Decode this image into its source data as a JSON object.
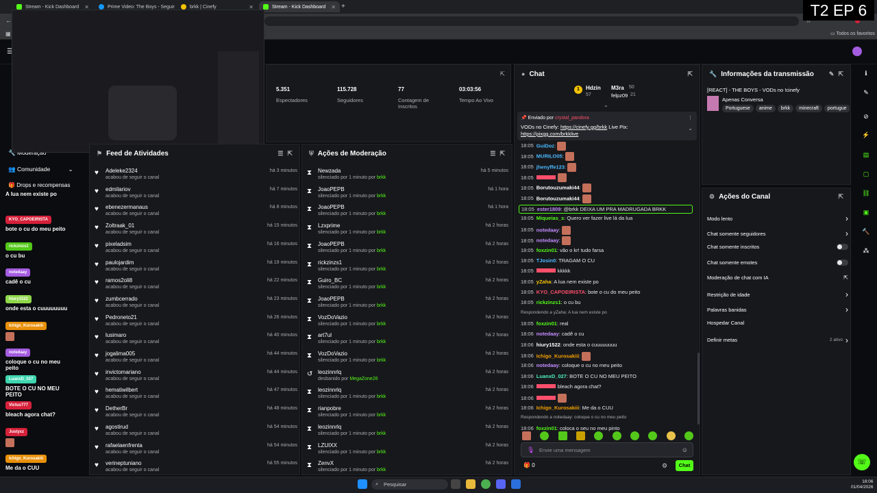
{
  "tabs": [
    {
      "label": "Stream - Kick Dashboard",
      "fav": "#53fc18"
    },
    {
      "label": "Prime Video: The Boys - Seguir",
      "fav": "#1399ff"
    },
    {
      "label": "brkk | Cinefy",
      "fav": "#f4c300"
    },
    {
      "label": "Stream - Kick Dashboard",
      "fav": "#53fc18"
    }
  ],
  "badge": "T2 EP 6",
  "bookmarks": "Todos os favoritos",
  "stats": [
    {
      "value": "5.351",
      "label": "Espectadores"
    },
    {
      "value": "115.728",
      "label": "Seguidores"
    },
    {
      "value": "77",
      "label": "Contagem de Inscritos"
    },
    {
      "value": "03:03:56",
      "label": "Tempo Ao Vivo"
    }
  ],
  "leftnav": {
    "moderation": "Moderação",
    "community": "Comunidade",
    "drops": "Drops e recompensas"
  },
  "feed": {
    "title": "Feed de Atividades",
    "desc": "acabou de seguir o canal",
    "rows": [
      {
        "name": "Adeleke2324",
        "time": "há 3 minutos"
      },
      {
        "name": "edmilariov",
        "time": "há 7 minutos"
      },
      {
        "name": "ebenezermanaus",
        "time": "há 8 minutos"
      },
      {
        "name": "Zoltraak_01",
        "time": "há 15 minutos"
      },
      {
        "name": "pixeladsim",
        "time": "há 16 minutos"
      },
      {
        "name": "paulojardim",
        "time": "há 19 minutos"
      },
      {
        "name": "ramos2oli8",
        "time": "há 22 minutos"
      },
      {
        "name": "zumbcerrado",
        "time": "há 23 minutos"
      },
      {
        "name": "Pedroneto21",
        "time": "há 26 minutos"
      },
      {
        "name": "lusimaro",
        "time": "há 40 minutos"
      },
      {
        "name": "jogalima005",
        "time": "há 44 minutos"
      },
      {
        "name": "invictomariano",
        "time": "há 44 minutos"
      },
      {
        "name": "hematiwilbert",
        "time": "há 47 minutos"
      },
      {
        "name": "DetherBr",
        "time": "há 48 minutos"
      },
      {
        "name": "agostirud",
        "time": "há 54 minutos"
      },
      {
        "name": "rafaelaenfrenta",
        "time": "há 54 minutos"
      },
      {
        "name": "verineptuniano",
        "time": "há 55 minutos"
      }
    ]
  },
  "moderation": {
    "title": "Ações de Moderação",
    "rows": [
      {
        "name": "Newzada",
        "desc": "silenciado por 1 minuto por ",
        "by": "brkk",
        "time": "há 5 minutos"
      },
      {
        "name": "JoaoPEPB",
        "desc": "silenciado por 1 minuto por ",
        "by": "brkk",
        "time": "há 1 hora"
      },
      {
        "name": "JoaoPEPB",
        "desc": "silenciado por 1 minuto por ",
        "by": "brkk",
        "time": "há 1 hora"
      },
      {
        "name": "Lzxprime",
        "desc": "silenciado por 1 minuto por ",
        "by": "brkk",
        "time": "há 2 horas"
      },
      {
        "name": "JoaoPEPB",
        "desc": "silenciado por 1 minuto por ",
        "by": "brkk",
        "time": "há 2 horas"
      },
      {
        "name": "rickzinzs1",
        "desc": "silenciado por 1 minuto por ",
        "by": "brkk",
        "time": "há 2 horas"
      },
      {
        "name": "Guiro_BC",
        "desc": "silenciado por 1 minuto por ",
        "by": "brkk",
        "time": "há 2 horas"
      },
      {
        "name": "JoaoPEPB",
        "desc": "silenciado por 1 minuto por ",
        "by": "brkk",
        "time": "há 2 horas"
      },
      {
        "name": "VozDoVazio",
        "desc": "silenciado por 1 minuto por ",
        "by": "brkk",
        "time": "há 2 horas"
      },
      {
        "name": "art7ul",
        "desc": "silenciado por 1 minuto por ",
        "by": "brkk",
        "time": "há 2 horas"
      },
      {
        "name": "VozDoVazio",
        "desc": "silenciado por 1 minuto por ",
        "by": "brkk",
        "time": "há 2 horas"
      },
      {
        "name": "leozinnrlq",
        "desc": "desbanido por ",
        "by": "MegaZone26",
        "time": "há 2 horas"
      },
      {
        "name": "leozinnrlq",
        "desc": "silenciado por 1 minuto por ",
        "by": "brkk",
        "time": "há 2 horas"
      },
      {
        "name": "rianpobre",
        "desc": "silenciado por 1 minuto por ",
        "by": "brkk",
        "time": "há 2 horas"
      },
      {
        "name": "leozinnrlq",
        "desc": "silenciado por 1 minuto por ",
        "by": "brkk",
        "time": "há 2 horas"
      },
      {
        "name": "LZUIXX",
        "desc": "silenciado por 1 minuto por ",
        "by": "brkk",
        "time": "há 2 horas"
      },
      {
        "name": "ZenvX",
        "desc": "silenciado por 1 minuto por ",
        "by": "brkk",
        "time": "há 2 horas"
      }
    ]
  },
  "chat": {
    "title": "Chat",
    "leaders": [
      {
        "name": "Hdzin",
        "count": "57"
      },
      {
        "name": "M3ra",
        "count": "50"
      },
      {
        "name": "felpz09",
        "count": "21"
      }
    ],
    "pinned_by": "Enviado por",
    "pinned_user": "crystal_pandora",
    "pinned_text": "VODs no Cinefy: ",
    "pinned_link1": "https://cinefy.gg/brkk",
    "pinned_mid": " Live Pix: ",
    "pinned_link2": "https://pixgg.com/brkklive",
    "placeholder": "Envie uma mensagem",
    "count": "0",
    "send": "Chat",
    "messages": [
      {
        "t": "18:05",
        "u": "GuiDoz",
        "c": "#4cb9ff",
        "m": "",
        "e": true
      },
      {
        "t": "18:05",
        "u": "MURILO05",
        "c": "#4cb9ff",
        "m": "",
        "e": true
      },
      {
        "t": "18:05",
        "u": "jhenyffe123",
        "c": "#4cb9ff",
        "m": "",
        "e": true
      },
      {
        "t": "18:05",
        "u": "",
        "c": "#ff4f6b",
        "m": "",
        "e": true
      },
      {
        "t": "18:05",
        "u": "Borutouzumaki44",
        "c": "#fff",
        "m": "",
        "e": true
      },
      {
        "t": "18:05",
        "u": "Borutouzumaki44",
        "c": "#fff",
        "m": "",
        "e": true
      },
      {
        "t": "18:05",
        "u": "ester1809",
        "c": "#c48cff",
        "m": "@brkk DEIXA UM PRA MADRUGADA BRKK",
        "e": false,
        "hl": true
      },
      {
        "t": "18:05",
        "u": "Miqueias_s",
        "c": "#53fc18",
        "m": "Quero ver fazer live lá da lua",
        "e": false
      },
      {
        "t": "18:05",
        "u": "notedaay",
        "c": "#c48cff",
        "m": "",
        "e": true
      },
      {
        "t": "18:05",
        "u": "notedaay",
        "c": "#c48cff",
        "m": "",
        "e": true
      },
      {
        "t": "18:05",
        "u": "foxzin01",
        "c": "#53fc18",
        "m": "vão o kr! tudo farsa",
        "e": false
      },
      {
        "t": "18:05",
        "u": "TJosin0",
        "c": "#4cb9ff",
        "m": "TRAGAM O CU",
        "e": false
      },
      {
        "t": "18:05",
        "u": "",
        "c": "#ff4f6b",
        "m": "kkkkk",
        "e": false
      },
      {
        "t": "18:05",
        "u": "yZaha",
        "c": "#f4c300",
        "m": "A lua nem existe po",
        "e": false
      },
      {
        "t": "18:05",
        "u": "KYO_CAPOEIRISTA",
        "c": "#ff4f6b",
        "m": "bote o cu do meu peito",
        "e": false
      },
      {
        "t": "18:05",
        "u": "rickzinzs1",
        "c": "#53fc18",
        "m": "o cu bu",
        "e": false
      },
      {
        "t": "",
        "u": "",
        "c": "#a8abb1",
        "m": "Respondendo a yZaha: A lua nem existe po",
        "e": false,
        "reply": true
      },
      {
        "t": "18:05",
        "u": "foxzin01",
        "c": "#53fc18",
        "m": "real",
        "e": false
      },
      {
        "t": "18:06",
        "u": "notedaay",
        "c": "#c48cff",
        "m": "cadê o cu",
        "e": false
      },
      {
        "t": "18:06",
        "u": "hiury1522",
        "c": "#fff",
        "m": "onde esta o cuuuuuuuu",
        "e": false
      },
      {
        "t": "18:06",
        "u": "Ichigo_Kurosakiii",
        "c": "#f4a000",
        "m": "",
        "e": true
      },
      {
        "t": "18:06",
        "u": "notedaay",
        "c": "#c48cff",
        "m": "coloque o cu no meu peito",
        "e": false
      },
      {
        "t": "18:06",
        "u": "LuanxD_027",
        "c": "#4cf0c0",
        "m": "BOTE O CU NO MEU PEITO",
        "e": false
      },
      {
        "t": "18:06",
        "u": "",
        "c": "#ff4f6b",
        "m": "bleach agora chat?",
        "e": false
      },
      {
        "t": "18:06",
        "u": "",
        "c": "#ff4f6b",
        "m": "",
        "e": true
      },
      {
        "t": "18:06",
        "u": "Ichigo_Kurosakiii",
        "c": "#f4a000",
        "m": "Me da o CUU",
        "e": false
      },
      {
        "t": "",
        "u": "",
        "c": "#a8abb1",
        "m": "Respondendo a notedaay: coloque o cu no meu peito",
        "e": false,
        "reply": true
      },
      {
        "t": "18:06",
        "u": "foxzin01",
        "c": "#53fc18",
        "m": "coloca o seu no meu pinto",
        "e": false
      }
    ]
  },
  "info": {
    "title": "Informações da transmissão",
    "stream_title": "[REACT] - THE BOYS - VODs no !cinefy",
    "category": "Apenas Conversa",
    "tags": [
      "Portuguese",
      "anime",
      "brkk",
      "minecraft",
      "portugue"
    ]
  },
  "channel": {
    "title": "Ações do Canal",
    "items": [
      {
        "label": "Modo lento",
        "ctrl": "chevron"
      },
      {
        "label": "Chat somente seguidores",
        "ctrl": "chevron"
      },
      {
        "label": "Chat somente inscritos",
        "ctrl": "toggle"
      },
      {
        "label": "Chat somente emotes",
        "ctrl": "toggle"
      },
      {
        "label": "Moderação de chat com IA",
        "ctrl": "ext"
      },
      {
        "label": "Restrição de idade",
        "ctrl": "chevron"
      },
      {
        "label": "Palavras banidas",
        "ctrl": "chevron"
      },
      {
        "label": "Hospedar Canal",
        "ctrl": "none"
      },
      {
        "label": "Definir metas",
        "ctrl": "chevron",
        "extra": "2 ativo"
      }
    ]
  },
  "overlay": [
    {
      "user": "",
      "color": "",
      "text": "A lua nem existe po"
    },
    {
      "user": "KYO_CAPOEIRISTA",
      "color": "#d6213a",
      "text": "bote o cu do meu peito"
    },
    {
      "user": "rickzinzs1",
      "color": "#53c81a",
      "text": "o cu bu"
    },
    {
      "user": "notedaay",
      "color": "#a45ce0",
      "text": "cadê o cu"
    },
    {
      "user": "hiury1522",
      "color": "#8fd84a",
      "text": "onde esta o cuuuuuuuu"
    },
    {
      "user": "Ichigo_Kurosakiii",
      "color": "#e8900a",
      "text": ""
    },
    {
      "user": "notedaay",
      "color": "#a45ce0",
      "text": "coloque o cu no meu peito"
    },
    {
      "user": "LuanxD_027",
      "color": "#3fd6b0",
      "text": "BOTE O CU NO MEU PEITO"
    },
    {
      "user": "Victus777",
      "color": "#d6213a",
      "text": "bleach agora chat?"
    },
    {
      "user": "Justyxz",
      "color": "#d6213a",
      "text": ""
    },
    {
      "user": "Ichigo_Kurosakiii",
      "color": "#e8900a",
      "text": "Me da o CUU"
    }
  ],
  "taskbar": {
    "search": "Pesquisar",
    "time": "18:06",
    "date": "01/04/2026"
  }
}
